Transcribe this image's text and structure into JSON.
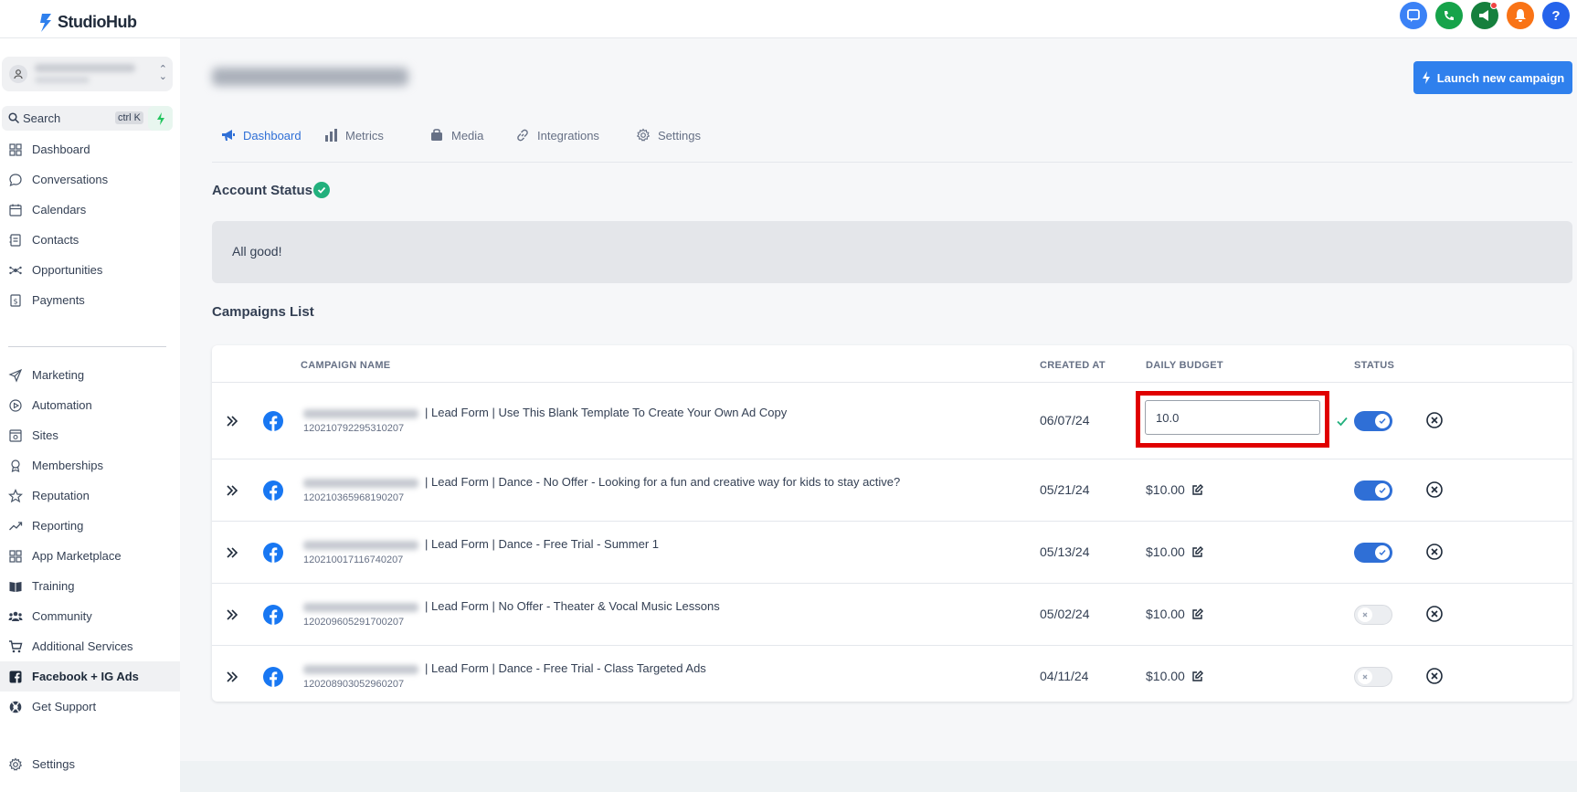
{
  "app": {
    "name": "StudioHub"
  },
  "sidebar": {
    "search": {
      "label": "Search",
      "shortcut": "ctrl K"
    },
    "items": [
      {
        "label": "Dashboard",
        "icon": "grid-icon"
      },
      {
        "label": "Conversations",
        "icon": "chat-icon"
      },
      {
        "label": "Calendars",
        "icon": "calendar-icon"
      },
      {
        "label": "Contacts",
        "icon": "contacts-icon"
      },
      {
        "label": "Opportunities",
        "icon": "opportunities-icon"
      },
      {
        "label": "Payments",
        "icon": "payments-icon"
      },
      {
        "label": "Marketing",
        "icon": "send-icon"
      },
      {
        "label": "Automation",
        "icon": "automation-icon"
      },
      {
        "label": "Sites",
        "icon": "sites-icon"
      },
      {
        "label": "Memberships",
        "icon": "memberships-icon"
      },
      {
        "label": "Reputation",
        "icon": "star-icon"
      },
      {
        "label": "Reporting",
        "icon": "trend-icon"
      },
      {
        "label": "App Marketplace",
        "icon": "apps-icon"
      },
      {
        "label": "Training",
        "icon": "book-icon"
      },
      {
        "label": "Community",
        "icon": "community-icon"
      },
      {
        "label": "Additional Services",
        "icon": "cart-icon"
      },
      {
        "label": "Facebook + IG Ads",
        "icon": "facebook-square-icon",
        "active": true
      },
      {
        "label": "Get Support",
        "icon": "support-icon"
      }
    ],
    "settings": "Settings"
  },
  "header": {
    "launch_button": "Launch new campaign"
  },
  "tabs": [
    {
      "label": "Dashboard",
      "active": true
    },
    {
      "label": "Metrics"
    },
    {
      "label": "Media"
    },
    {
      "label": "Integrations"
    },
    {
      "label": "Settings"
    }
  ],
  "account_status": {
    "title": "Account Status",
    "message": "All good!"
  },
  "campaigns": {
    "title": "Campaigns List",
    "columns": {
      "name": "CAMPAIGN NAME",
      "created": "CREATED AT",
      "budget": "DAILY BUDGET",
      "status": "STATUS"
    },
    "rows": [
      {
        "name": "| Lead Form | Use This Blank Template To Create Your Own Ad Copy",
        "id": "120210792295310207",
        "created": "06/07/24",
        "budget_input": "10.0",
        "active": true
      },
      {
        "name": "| Lead Form | Dance - No Offer - Looking for a fun and creative way for kids to stay active?",
        "id": "120210365968190207",
        "created": "05/21/24",
        "budget": "$10.00",
        "active": true
      },
      {
        "name": "| Lead Form | Dance - Free Trial - Summer 1",
        "id": "120210017116740207",
        "created": "05/13/24",
        "budget": "$10.00",
        "active": true
      },
      {
        "name": "| Lead Form | No Offer - Theater & Vocal Music Lessons",
        "id": "120209605291700207",
        "created": "05/02/24",
        "budget": "$10.00",
        "active": false
      },
      {
        "name": "| Lead Form | Dance - Free Trial - Class Targeted Ads",
        "id": "120208903052960207",
        "created": "04/11/24",
        "budget": "$10.00",
        "active": false
      }
    ]
  },
  "colors": {
    "accent": "#2f6fd6",
    "button": "#2f80ed",
    "success": "#22b07d",
    "highlight": "#e00000"
  }
}
